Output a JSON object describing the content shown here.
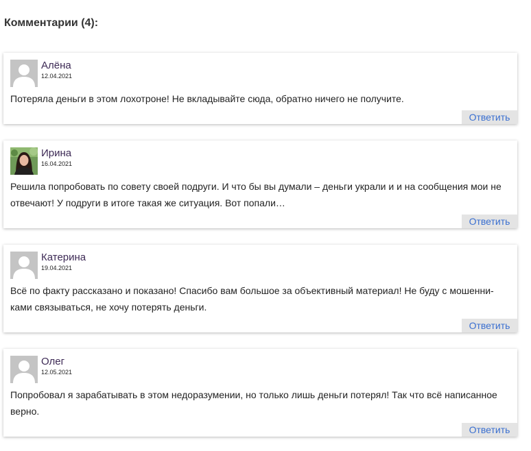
{
  "comments_title": "Комментарии (4):",
  "comments": [
    {
      "author": "Алёна",
      "date": "12.04.2021",
      "text": "Потеряла деньги в этом лохотроне! Не вкладывайте сюда, обратно ничего не получите.",
      "reply_label": "Ответить",
      "avatar": "default-avatar-icon"
    },
    {
      "author": "Ирина",
      "date": "16.04.2021",
      "text": "Решила попробовать по совету своей подруги. И что бы вы думали – деньги украли и и на сообщения мои не отвечают! У подруги в итоге такая же ситуация. Вот попали…",
      "reply_label": "Ответить",
      "avatar": "user-photo"
    },
    {
      "author": "Катерина",
      "date": "19.04.2021",
      "text": "Всё по факту рассказано и показано! Спасибо вам большое за объективный материал! Не буду с мошенни-ками связываться, не хочу потерять деньги.",
      "reply_label": "Ответить",
      "avatar": "default-avatar-icon"
    },
    {
      "author": "Олег",
      "date": "12.05.2021",
      "text": "Попробовал я зарабатывать в этом недоразумении, но только лишь деньги потерял! Так что всё написанное верно.",
      "reply_label": "Ответить",
      "avatar": "default-avatar-icon"
    }
  ],
  "colors": {
    "author": "#3d2a55",
    "reply_text": "#3a6fd0",
    "reply_bg": "#e4e4e4",
    "avatar_bg": "#c4c4c4"
  }
}
